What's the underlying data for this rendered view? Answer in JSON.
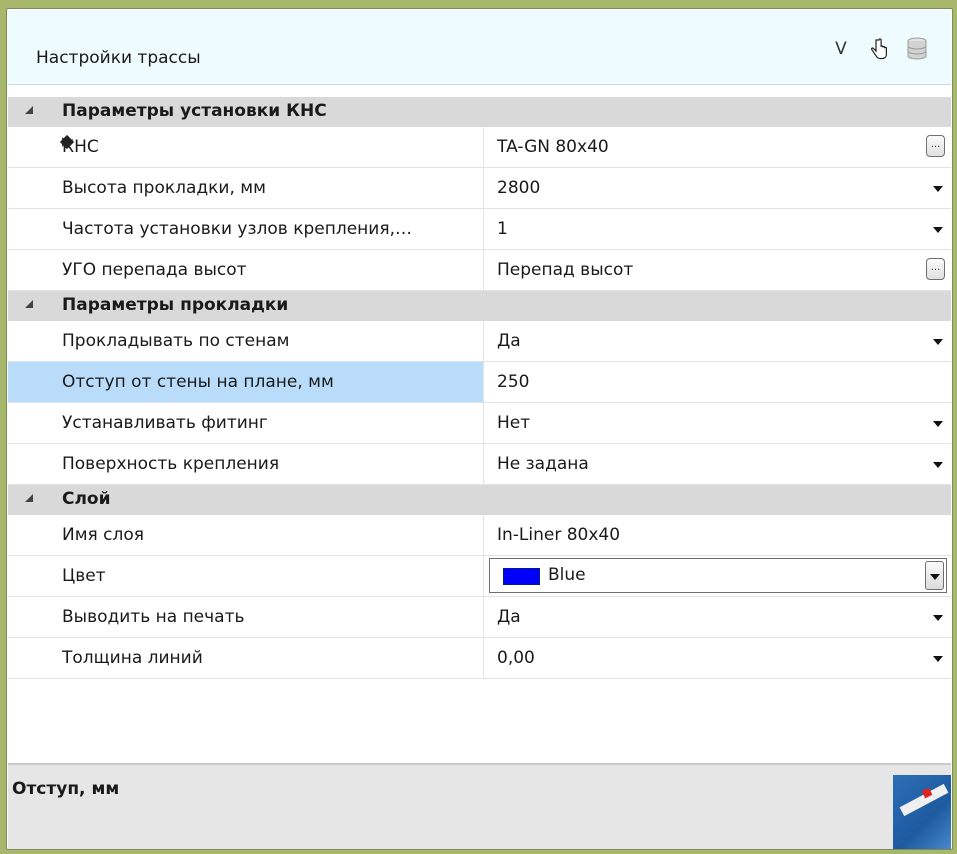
{
  "window": {
    "title": "Настройки трассы",
    "toolbar": {
      "v_label": "V"
    }
  },
  "categories": [
    {
      "label": "Параметры установки КНС",
      "rows": [
        {
          "name": "КНС",
          "value": "TA-GN 80x40",
          "editor": "ellipsis",
          "expandable": true,
          "marker": true
        },
        {
          "name": "Высота прокладки, мм",
          "value": "2800",
          "editor": "dropdown"
        },
        {
          "name": "Частота установки узлов крепления,…",
          "value": "1",
          "editor": "dropdown"
        },
        {
          "name": "УГО перепада высот",
          "value": "Перепад высот",
          "editor": "ellipsis"
        }
      ]
    },
    {
      "label": "Параметры прокладки",
      "rows": [
        {
          "name": "Прокладывать по стенам",
          "value": "Да",
          "editor": "dropdown"
        },
        {
          "name": "Отступ от стены на плане, мм",
          "value": "250",
          "editor": "none",
          "selected": true
        },
        {
          "name": "Устанавливать фитинг",
          "value": "Нет",
          "editor": "dropdown"
        },
        {
          "name": "Поверхность крепления",
          "value": "Не задана",
          "editor": "dropdown"
        }
      ]
    },
    {
      "label": "Слой",
      "rows": [
        {
          "name": "Имя слоя",
          "value": "In-Liner 80x40",
          "editor": "none"
        },
        {
          "name": "Цвет",
          "value": "Blue",
          "editor": "color-combo",
          "color": "#0000ff"
        },
        {
          "name": "Выводить на печать",
          "value": "Да",
          "editor": "dropdown"
        },
        {
          "name": "Толщина линий",
          "value": "0,00",
          "editor": "dropdown"
        }
      ]
    }
  ],
  "description": {
    "title": "Отступ, мм"
  },
  "colors": {
    "selected": "#b9dcfb",
    "category": "#d9d9d9",
    "titlebar": "#eefcff"
  }
}
